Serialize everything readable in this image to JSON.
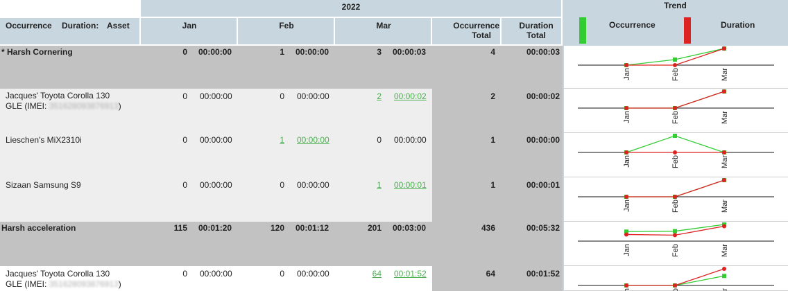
{
  "header": {
    "year": "2022",
    "occurrence_col": "Occurrence",
    "duration_col": "Duration:",
    "asset_col": "Asset",
    "months": [
      "Jan",
      "Feb",
      "Mar"
    ],
    "occ_total": [
      "Occurrence",
      "Total"
    ],
    "dur_total": [
      "Duration",
      "Total"
    ],
    "trend": "Trend",
    "legend_occurrence": "Occurrence",
    "legend_duration": "Duration"
  },
  "colors": {
    "header_bg": "#c8d6e0",
    "occurrence_series": "#33cc33",
    "duration_series": "#dd2222",
    "link": "#4caf50",
    "group_row_bg": "#c2c2c2",
    "asset_row_bg": "#eeeeee"
  },
  "rows": [
    {
      "type": "group",
      "name": "* Harsh Cornering",
      "cells": [
        [
          "0",
          "00:00:00"
        ],
        [
          "1",
          "00:00:00"
        ],
        [
          "3",
          "00:00:03"
        ]
      ],
      "links": [
        false,
        false,
        false
      ],
      "occ_total": "4",
      "dur_total": "00:00:03"
    },
    {
      "type": "asset",
      "name_line1": "Jacques' Toyota Corolla 130",
      "name_line2_prefix": "GLE (IMEI: ",
      "name_line2_blurred": "351628093876913",
      "name_line2_suffix": ")",
      "cells": [
        [
          "0",
          "00:00:00"
        ],
        [
          "0",
          "00:00:00"
        ],
        [
          "2",
          "00:00:02"
        ]
      ],
      "links": [
        false,
        false,
        true
      ],
      "occ_total": "2",
      "dur_total": "00:00:02"
    },
    {
      "type": "asset",
      "name_line1": "Lieschen's MiX2310i",
      "cells": [
        [
          "0",
          "00:00:00"
        ],
        [
          "1",
          "00:00:00"
        ],
        [
          "0",
          "00:00:00"
        ]
      ],
      "links": [
        false,
        true,
        false
      ],
      "occ_total": "1",
      "dur_total": "00:00:00"
    },
    {
      "type": "asset",
      "name_line1": "Sizaan Samsung S9",
      "cells": [
        [
          "0",
          "00:00:00"
        ],
        [
          "0",
          "00:00:00"
        ],
        [
          "1",
          "00:00:01"
        ]
      ],
      "links": [
        false,
        false,
        true
      ],
      "occ_total": "1",
      "dur_total": "00:00:01"
    },
    {
      "type": "group",
      "name": "Harsh acceleration",
      "cells": [
        [
          "115",
          "00:01:20"
        ],
        [
          "120",
          "00:01:12"
        ],
        [
          "201",
          "00:03:00"
        ]
      ],
      "links": [
        false,
        false,
        false
      ],
      "occ_total": "436",
      "dur_total": "00:05:32"
    },
    {
      "type": "asset",
      "name_line1": "Jacques' Toyota Corolla 130",
      "name_line2_prefix": "GLE (IMEI: ",
      "name_line2_blurred": "351628093876913",
      "name_line2_suffix": ")",
      "cells": [
        [
          "0",
          "00:00:00"
        ],
        [
          "0",
          "00:00:00"
        ],
        [
          "64",
          "00:01:52"
        ]
      ],
      "links": [
        false,
        false,
        true
      ],
      "occ_total": "64",
      "dur_total": "00:01:52"
    }
  ],
  "trend_axis_labels": [
    "Jan",
    "Feb",
    "Mar"
  ],
  "chart_data": [
    {
      "type": "line",
      "categories": [
        "Jan",
        "Feb",
        "Mar"
      ],
      "series": [
        {
          "name": "Occurrence",
          "values": [
            0,
            1,
            3
          ]
        },
        {
          "name": "Duration",
          "values": [
            0,
            0,
            3
          ]
        }
      ]
    },
    {
      "type": "line",
      "categories": [
        "Jan",
        "Feb",
        "Mar"
      ],
      "series": [
        {
          "name": "Occurrence",
          "values": [
            0,
            0,
            2
          ]
        },
        {
          "name": "Duration",
          "values": [
            0,
            0,
            2
          ]
        }
      ]
    },
    {
      "type": "line",
      "categories": [
        "Jan",
        "Feb",
        "Mar"
      ],
      "series": [
        {
          "name": "Occurrence",
          "values": [
            0,
            1,
            0
          ]
        },
        {
          "name": "Duration",
          "values": [
            0,
            0,
            0
          ]
        }
      ]
    },
    {
      "type": "line",
      "categories": [
        "Jan",
        "Feb",
        "Mar"
      ],
      "series": [
        {
          "name": "Occurrence",
          "values": [
            0,
            0,
            1
          ]
        },
        {
          "name": "Duration",
          "values": [
            0,
            0,
            1
          ]
        }
      ]
    },
    {
      "type": "line",
      "categories": [
        "Jan",
        "Feb",
        "Mar"
      ],
      "series": [
        {
          "name": "Occurrence",
          "values": [
            115,
            120,
            201
          ]
        },
        {
          "name": "Duration",
          "values": [
            80,
            72,
            180
          ]
        }
      ]
    },
    {
      "type": "line",
      "categories": [
        "Jan",
        "Feb",
        "Mar"
      ],
      "series": [
        {
          "name": "Occurrence",
          "values": [
            0,
            0,
            64
          ]
        },
        {
          "name": "Duration",
          "values": [
            0,
            0,
            112
          ]
        }
      ]
    }
  ]
}
